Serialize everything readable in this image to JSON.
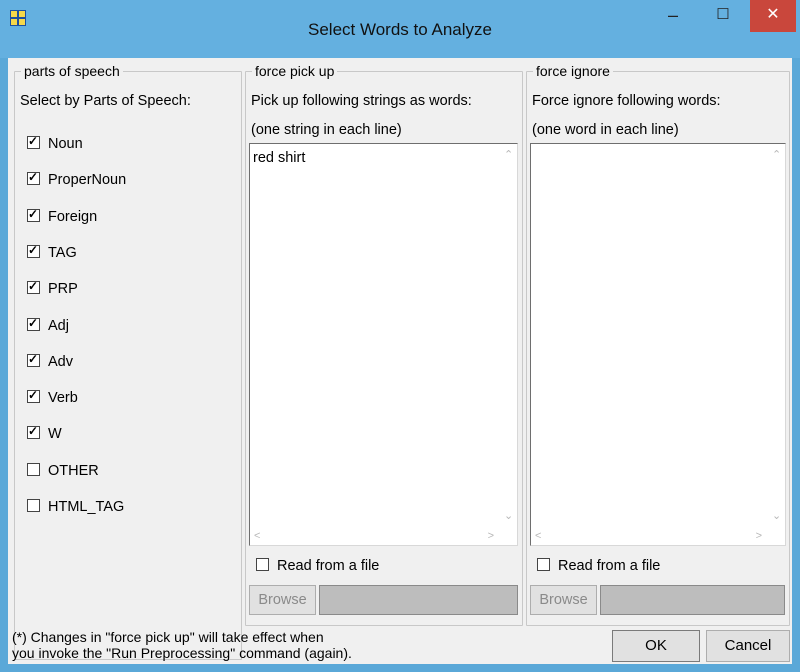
{
  "window": {
    "title": "Select Words to Analyze",
    "minimize_glyph": "–",
    "maximize_glyph": "☐",
    "close_glyph": "✕",
    "icon": "app-grid-icon"
  },
  "pos_group": {
    "legend": "parts of speech",
    "heading": "Select by Parts of Speech:",
    "items": [
      {
        "label": "Noun",
        "checked": true
      },
      {
        "label": "ProperNoun",
        "checked": true
      },
      {
        "label": "Foreign",
        "checked": true
      },
      {
        "label": "TAG",
        "checked": true
      },
      {
        "label": "PRP",
        "checked": true
      },
      {
        "label": "Adj",
        "checked": true
      },
      {
        "label": "Adv",
        "checked": true
      },
      {
        "label": "Verb",
        "checked": true
      },
      {
        "label": "W",
        "checked": true
      },
      {
        "label": "OTHER",
        "checked": false
      },
      {
        "label": "HTML_TAG",
        "checked": false
      }
    ]
  },
  "pickup_group": {
    "legend": "force pick up",
    "line1": "Pick up following strings as words:",
    "line2": "(one string in each line)",
    "text": "red shirt",
    "read_file_label": "Read from a file",
    "read_file_checked": false,
    "browse_label": "Browse",
    "path_value": ""
  },
  "ignore_group": {
    "legend": "force ignore",
    "line1": "Force ignore following words:",
    "line2": "(one word in each line)",
    "text": "",
    "read_file_label": "Read from a file",
    "read_file_checked": false,
    "browse_label": "Browse",
    "path_value": ""
  },
  "footer": {
    "note_line1": "(*) Changes in \"force pick up\" will take effect when",
    "note_line2": "you invoke the \"Run Preprocessing\" command (again).",
    "ok_label": "OK",
    "cancel_label": "Cancel"
  }
}
